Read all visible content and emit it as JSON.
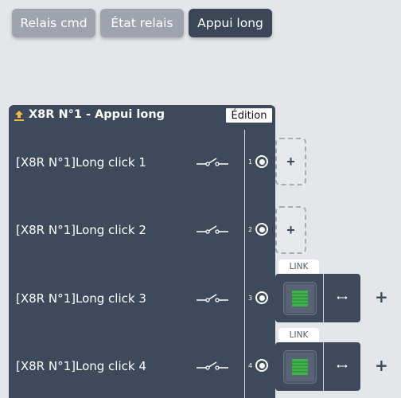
{
  "tabs": [
    {
      "label": "Relais cmd",
      "active": false
    },
    {
      "label": "État relais",
      "active": false
    },
    {
      "label": "Appui long",
      "active": true
    }
  ],
  "panel": {
    "title": "X8R N°1 - Appui long",
    "edit_label": "Édition",
    "icon": "upload-icon",
    "colors": {
      "panel_bg": "#3c4a5c",
      "icon_accent": "#f5b84a",
      "device_green": "#3fb24a"
    }
  },
  "channels": [
    {
      "label": "[X8R N°1]Long click 1",
      "number": "1",
      "slot": "add",
      "add_label": "+"
    },
    {
      "label": "[X8R N°1]Long click 2",
      "number": "2",
      "slot": "add",
      "add_label": "+"
    },
    {
      "label": "[X8R N°1]Long click 3",
      "number": "3",
      "slot": "link",
      "link_label": "LINK",
      "outer_plus": "+"
    },
    {
      "label": "[X8R N°1]Long click 4",
      "number": "4",
      "slot": "link",
      "link_label": "LINK",
      "outer_plus": "+"
    }
  ]
}
